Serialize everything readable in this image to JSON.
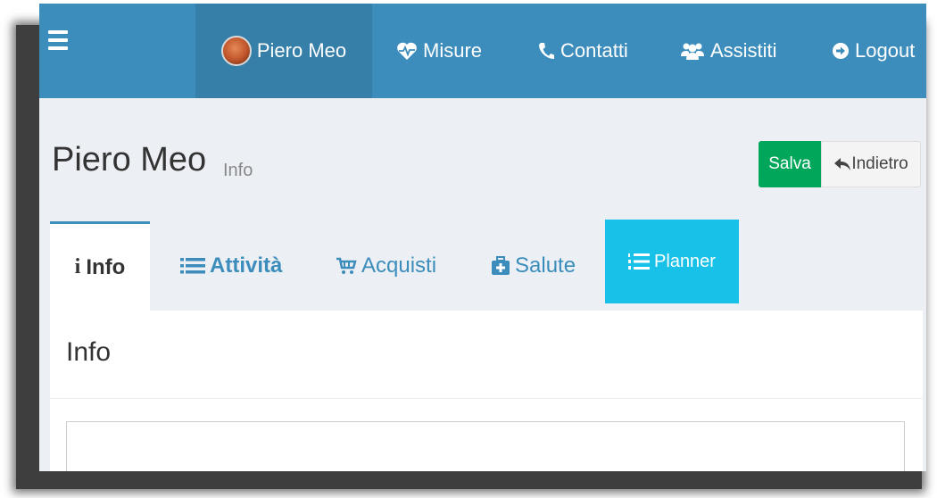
{
  "navbar": {
    "menu_icon": "hamburger-icon",
    "items": [
      {
        "label": "Piero Meo",
        "icon": "avatar",
        "active": true
      },
      {
        "label": "Misure",
        "icon": "heartbeat-icon"
      },
      {
        "label": "Contatti",
        "icon": "phone-icon"
      },
      {
        "label": "Assistiti",
        "icon": "users-icon"
      },
      {
        "label": "Logout",
        "icon": "logout-icon"
      }
    ]
  },
  "header": {
    "title": "Piero Meo",
    "subtitle": "Info",
    "save_label": "Salva",
    "back_label": "Indietro"
  },
  "tabs": [
    {
      "label": "Info",
      "icon": "info-icon",
      "active": true
    },
    {
      "label": "Attività",
      "icon": "list-icon"
    },
    {
      "label": "Acquisti",
      "icon": "cart-icon"
    },
    {
      "label": "Salute",
      "icon": "medkit-icon"
    },
    {
      "label": "Planner",
      "icon": "list-ol-icon",
      "highlighted": true
    }
  ],
  "panel": {
    "title": "Info"
  },
  "colors": {
    "navbar": "#3c8dbc",
    "save": "#00a65a",
    "planner": "#17c1e8",
    "background": "#ecf0f5"
  }
}
